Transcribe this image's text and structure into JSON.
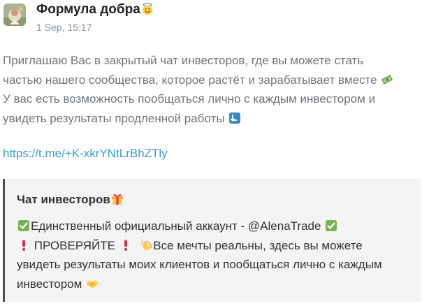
{
  "post": {
    "channel_name": "Формула добра",
    "timestamp": "1 Sep, 15:17",
    "body": {
      "line1": "Приглашаю Вас в закрытый чат инвесторов, где вы можете стать",
      "line2": "частью нашего сообщества, которое растёт и зарабатывает вместе",
      "line3": "У вас есть возможность пообщаться лично с каждым инвестором и",
      "line4": "увидеть результаты продленной работы"
    },
    "link": "https://t.me/+K-xkrYNtLrBhZTly",
    "quote": {
      "title": "Чат инвесторов",
      "line1": "Единственный официальный аккаунт - @AlenaTrade",
      "line2_a": "ПРОВЕРЯЙТЕ",
      "line2_b": "Все мечты реальны, здесь вы можете",
      "line3": "увидеть результаты моих клиентов и пообщаться лично с каждым",
      "line4": "инвестором"
    }
  },
  "icons": {
    "title_emoji": "smiling-face-with-halo-icon",
    "money_emoji": "money-with-wings-icon",
    "arrow_emoji": "arrow-down-icon",
    "gift_emoji": "gift-icon",
    "check_emoji": "check-mark-button-icon",
    "exclamation_emoji": "red-exclamation-icon",
    "clap_emoji": "clapping-hands-icon",
    "handshake_emoji": "handshake-icon"
  },
  "colors": {
    "link": "#3a9fd6",
    "body_text": "#70757a",
    "quote_bar": "#4f4f4f",
    "quote_bg": "#f4f4f4"
  }
}
